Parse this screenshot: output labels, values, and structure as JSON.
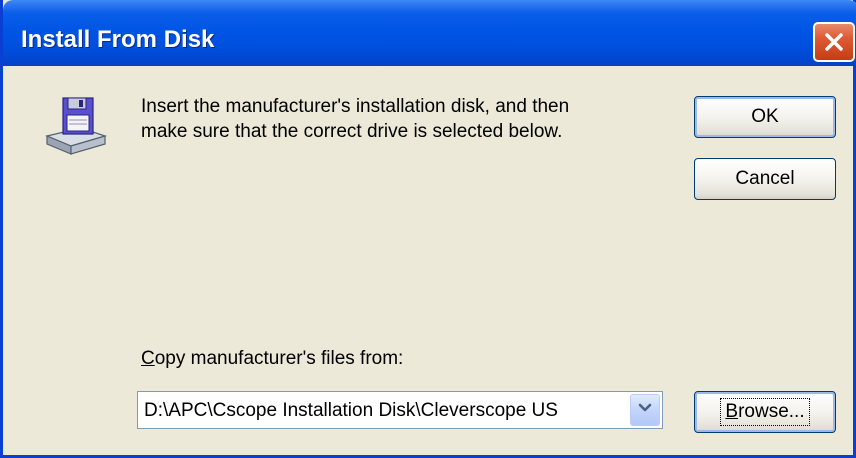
{
  "window": {
    "title": "Install From Disk"
  },
  "message": {
    "line1": "Insert the manufacturer's installation disk, and then",
    "line2": "make sure that the correct drive is selected below."
  },
  "buttons": {
    "ok_label": "OK",
    "cancel_label": "Cancel",
    "browse_label_underlined": "B",
    "browse_label_rest": "rowse..."
  },
  "copy_from": {
    "label_underlined": "C",
    "label_rest": "opy manufacturer's files from:",
    "value": "D:\\APC\\Cscope Installation Disk\\Cleverscope US"
  },
  "icons": {
    "dialog_icon": "floppy-disk-drive-icon",
    "close": "close-icon",
    "dropdown": "chevron-down-icon"
  },
  "colors": {
    "titlebar": "#0055e5",
    "close_button": "#dd5a33",
    "dialog_background": "#ece9d8"
  }
}
